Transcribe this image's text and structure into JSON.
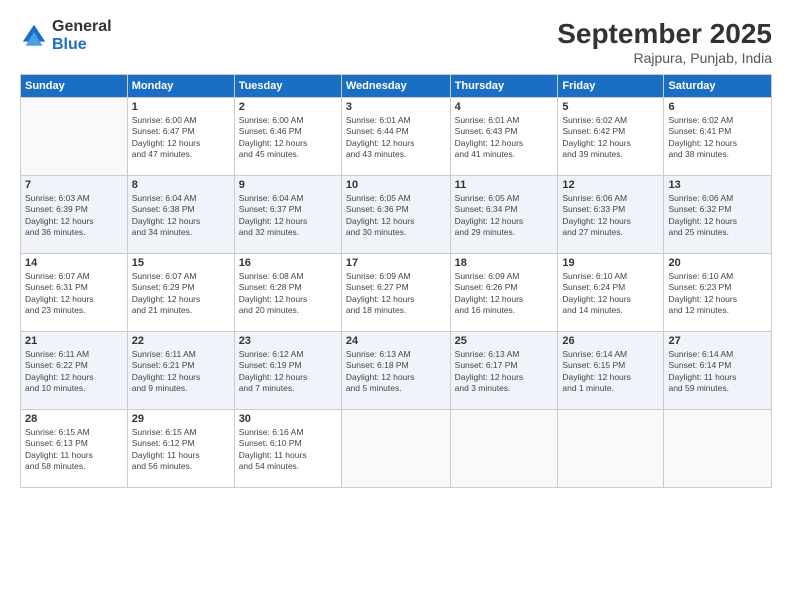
{
  "header": {
    "logo_general": "General",
    "logo_blue": "Blue",
    "month_title": "September 2025",
    "location": "Rajpura, Punjab, India"
  },
  "weekdays": [
    "Sunday",
    "Monday",
    "Tuesday",
    "Wednesday",
    "Thursday",
    "Friday",
    "Saturday"
  ],
  "weeks": [
    [
      {
        "day": "",
        "info": ""
      },
      {
        "day": "1",
        "info": "Sunrise: 6:00 AM\nSunset: 6:47 PM\nDaylight: 12 hours\nand 47 minutes."
      },
      {
        "day": "2",
        "info": "Sunrise: 6:00 AM\nSunset: 6:46 PM\nDaylight: 12 hours\nand 45 minutes."
      },
      {
        "day": "3",
        "info": "Sunrise: 6:01 AM\nSunset: 6:44 PM\nDaylight: 12 hours\nand 43 minutes."
      },
      {
        "day": "4",
        "info": "Sunrise: 6:01 AM\nSunset: 6:43 PM\nDaylight: 12 hours\nand 41 minutes."
      },
      {
        "day": "5",
        "info": "Sunrise: 6:02 AM\nSunset: 6:42 PM\nDaylight: 12 hours\nand 39 minutes."
      },
      {
        "day": "6",
        "info": "Sunrise: 6:02 AM\nSunset: 6:41 PM\nDaylight: 12 hours\nand 38 minutes."
      }
    ],
    [
      {
        "day": "7",
        "info": "Sunrise: 6:03 AM\nSunset: 6:39 PM\nDaylight: 12 hours\nand 36 minutes."
      },
      {
        "day": "8",
        "info": "Sunrise: 6:04 AM\nSunset: 6:38 PM\nDaylight: 12 hours\nand 34 minutes."
      },
      {
        "day": "9",
        "info": "Sunrise: 6:04 AM\nSunset: 6:37 PM\nDaylight: 12 hours\nand 32 minutes."
      },
      {
        "day": "10",
        "info": "Sunrise: 6:05 AM\nSunset: 6:36 PM\nDaylight: 12 hours\nand 30 minutes."
      },
      {
        "day": "11",
        "info": "Sunrise: 6:05 AM\nSunset: 6:34 PM\nDaylight: 12 hours\nand 29 minutes."
      },
      {
        "day": "12",
        "info": "Sunrise: 6:06 AM\nSunset: 6:33 PM\nDaylight: 12 hours\nand 27 minutes."
      },
      {
        "day": "13",
        "info": "Sunrise: 6:06 AM\nSunset: 6:32 PM\nDaylight: 12 hours\nand 25 minutes."
      }
    ],
    [
      {
        "day": "14",
        "info": "Sunrise: 6:07 AM\nSunset: 6:31 PM\nDaylight: 12 hours\nand 23 minutes."
      },
      {
        "day": "15",
        "info": "Sunrise: 6:07 AM\nSunset: 6:29 PM\nDaylight: 12 hours\nand 21 minutes."
      },
      {
        "day": "16",
        "info": "Sunrise: 6:08 AM\nSunset: 6:28 PM\nDaylight: 12 hours\nand 20 minutes."
      },
      {
        "day": "17",
        "info": "Sunrise: 6:09 AM\nSunset: 6:27 PM\nDaylight: 12 hours\nand 18 minutes."
      },
      {
        "day": "18",
        "info": "Sunrise: 6:09 AM\nSunset: 6:26 PM\nDaylight: 12 hours\nand 16 minutes."
      },
      {
        "day": "19",
        "info": "Sunrise: 6:10 AM\nSunset: 6:24 PM\nDaylight: 12 hours\nand 14 minutes."
      },
      {
        "day": "20",
        "info": "Sunrise: 6:10 AM\nSunset: 6:23 PM\nDaylight: 12 hours\nand 12 minutes."
      }
    ],
    [
      {
        "day": "21",
        "info": "Sunrise: 6:11 AM\nSunset: 6:22 PM\nDaylight: 12 hours\nand 10 minutes."
      },
      {
        "day": "22",
        "info": "Sunrise: 6:11 AM\nSunset: 6:21 PM\nDaylight: 12 hours\nand 9 minutes."
      },
      {
        "day": "23",
        "info": "Sunrise: 6:12 AM\nSunset: 6:19 PM\nDaylight: 12 hours\nand 7 minutes."
      },
      {
        "day": "24",
        "info": "Sunrise: 6:13 AM\nSunset: 6:18 PM\nDaylight: 12 hours\nand 5 minutes."
      },
      {
        "day": "25",
        "info": "Sunrise: 6:13 AM\nSunset: 6:17 PM\nDaylight: 12 hours\nand 3 minutes."
      },
      {
        "day": "26",
        "info": "Sunrise: 6:14 AM\nSunset: 6:15 PM\nDaylight: 12 hours\nand 1 minute."
      },
      {
        "day": "27",
        "info": "Sunrise: 6:14 AM\nSunset: 6:14 PM\nDaylight: 11 hours\nand 59 minutes."
      }
    ],
    [
      {
        "day": "28",
        "info": "Sunrise: 6:15 AM\nSunset: 6:13 PM\nDaylight: 11 hours\nand 58 minutes."
      },
      {
        "day": "29",
        "info": "Sunrise: 6:15 AM\nSunset: 6:12 PM\nDaylight: 11 hours\nand 56 minutes."
      },
      {
        "day": "30",
        "info": "Sunrise: 6:16 AM\nSunset: 6:10 PM\nDaylight: 11 hours\nand 54 minutes."
      },
      {
        "day": "",
        "info": ""
      },
      {
        "day": "",
        "info": ""
      },
      {
        "day": "",
        "info": ""
      },
      {
        "day": "",
        "info": ""
      }
    ]
  ]
}
